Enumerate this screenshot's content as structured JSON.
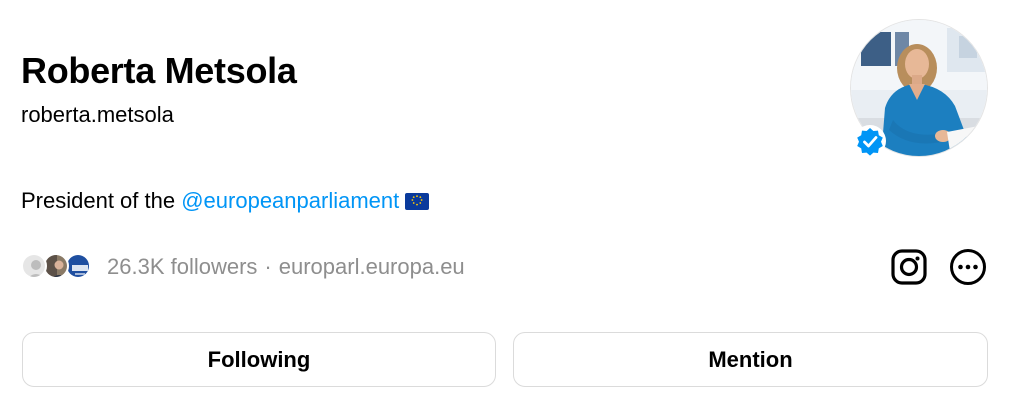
{
  "profile": {
    "display_name": "Roberta Metsola",
    "username": "roberta.metsola",
    "verified": true
  },
  "bio": {
    "prefix": "President of the ",
    "mention": "@europeanparliament",
    "flag_icon": "eu-flag-icon"
  },
  "stats": {
    "followers": "26.3K followers",
    "separator": "·",
    "link": "europarl.europa.eu"
  },
  "actions": {
    "following_label": "Following",
    "mention_label": "Mention"
  },
  "colors": {
    "link_blue": "#0095f6",
    "verified_blue": "#0095f6",
    "muted_text": "#8e8e8e",
    "button_border": "#dbdbdb"
  }
}
